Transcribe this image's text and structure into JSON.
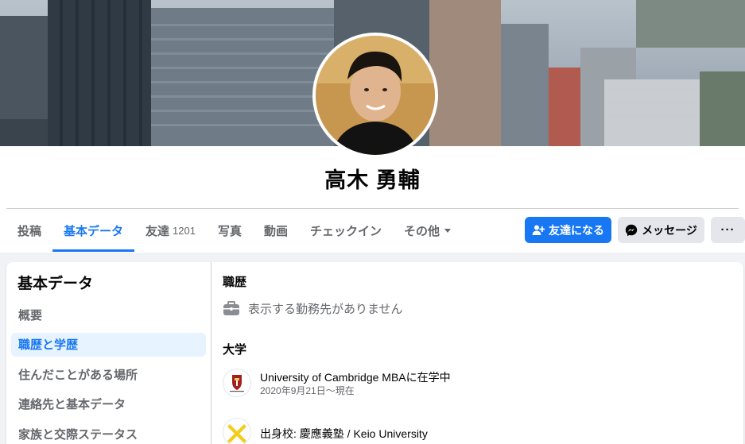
{
  "profile": {
    "name": "高木 勇輔"
  },
  "tabs": [
    {
      "label": "投稿",
      "count": ""
    },
    {
      "label": "基本データ",
      "count": ""
    },
    {
      "label": "友達",
      "count": "1201"
    },
    {
      "label": "写真",
      "count": ""
    },
    {
      "label": "動画",
      "count": ""
    },
    {
      "label": "チェックイン",
      "count": ""
    },
    {
      "label": "その他",
      "count": ""
    }
  ],
  "active_tab": "基本データ",
  "actions": {
    "add_friend": "友達になる",
    "message": "メッセージ",
    "more": "···"
  },
  "sidebar": {
    "title": "基本データ",
    "items": [
      {
        "label": "概要"
      },
      {
        "label": "職歴と学歴"
      },
      {
        "label": "住んだことがある場所"
      },
      {
        "label": "連絡先と基本データ"
      },
      {
        "label": "家族と交際ステータス"
      }
    ],
    "active_item": "職歴と学歴"
  },
  "work": {
    "title": "職歴",
    "empty_text": "表示する勤務先がありません",
    "icon": "briefcase-icon"
  },
  "education": {
    "title": "大学",
    "entries": [
      {
        "name": "University of Cambridge MBAに在学中",
        "date": "2020年9月21日〜現在",
        "logo": "cambridge-logo"
      },
      {
        "name": "出身校: 慶應義塾 / Keio University",
        "date": "",
        "logo": "keio-logo"
      }
    ]
  },
  "colors": {
    "accent": "#1877f2",
    "active_bg": "#e7f3ff",
    "secondary_button": "#e4e6eb",
    "muted_text": "#65676b"
  }
}
